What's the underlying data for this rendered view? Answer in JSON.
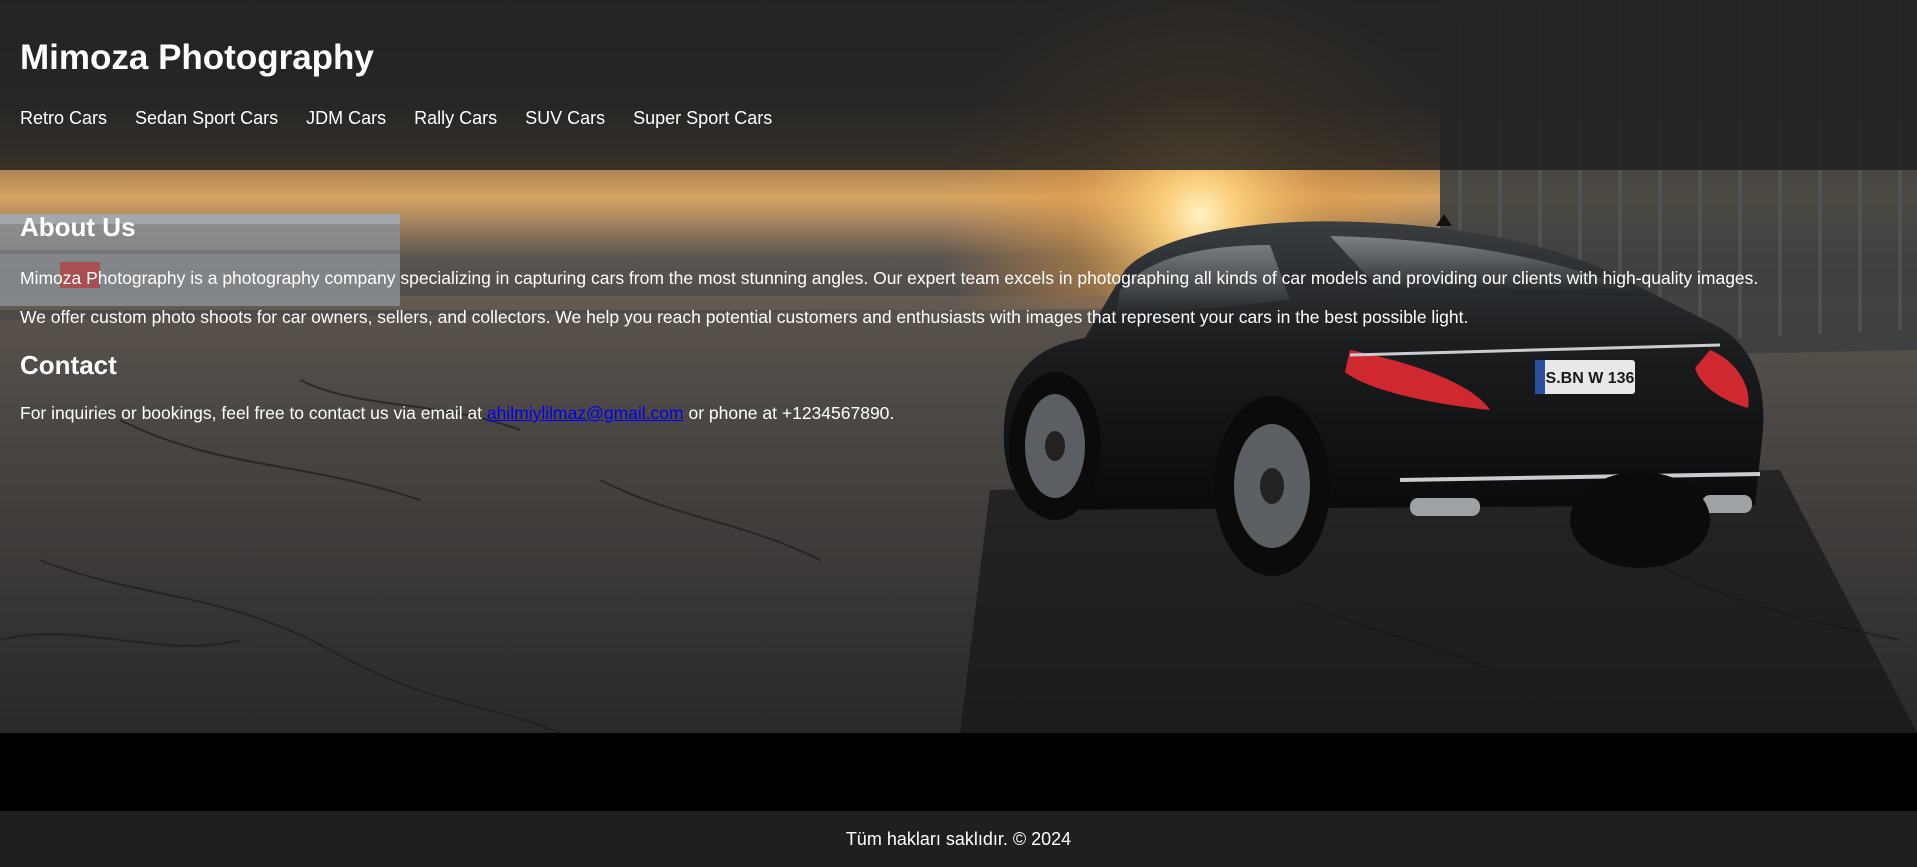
{
  "header": {
    "title": "Mimoza Photography",
    "nav": [
      {
        "label": "Retro Cars"
      },
      {
        "label": "Sedan Sport Cars"
      },
      {
        "label": "JDM Cars"
      },
      {
        "label": "Rally Cars"
      },
      {
        "label": "SUV Cars"
      },
      {
        "label": "Super Sport Cars"
      }
    ]
  },
  "about": {
    "heading": "About Us",
    "paragraph1": "Mimoza Photography is a photography company specializing in capturing cars from the most stunning angles. Our expert team excels in photographing all kinds of car models and providing our clients with high-quality images.",
    "paragraph2": "We offer custom photo shoots for car owners, sellers, and collectors. We help you reach potential customers and enthusiasts with images that represent your cars in the best possible light."
  },
  "contact": {
    "heading": "Contact",
    "text_before": "For inquiries or bookings, feel free to contact us via email at ",
    "email": "ahilmiylilmaz@gmail.com",
    "text_after": " or phone at +1234567890."
  },
  "footer": {
    "text": "Tüm hakları saklıdır. © 2024"
  },
  "hero": {
    "license_plate": "S.BN W 136"
  },
  "colors": {
    "header_bg": "#1e1e1e",
    "footer_bg": "#1d1f21",
    "link": "#0000ee",
    "text": "#ffffff"
  }
}
